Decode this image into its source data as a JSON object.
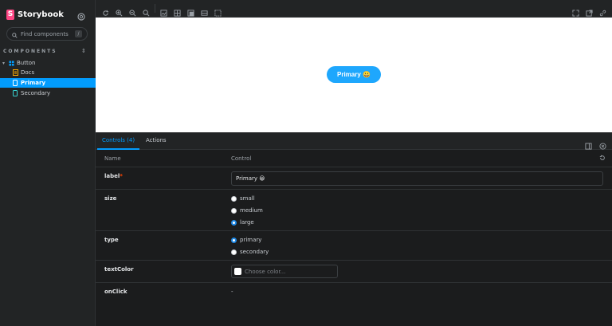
{
  "sidebar": {
    "brand": "Storybook",
    "brand_logo": "S",
    "search_placeholder": "Find components",
    "search_kbd": "/",
    "section_title": "COMPONENTS",
    "tree": {
      "group": "Button",
      "items": [
        {
          "label": "Docs",
          "icon": "docs-icon"
        },
        {
          "label": "Primary",
          "icon": "story-icon",
          "active": true
        },
        {
          "label": "Secondary",
          "icon": "story-icon"
        }
      ]
    }
  },
  "toolbar": {
    "icons": [
      "reload-icon",
      "zoom-in-icon",
      "zoom-out-icon",
      "zoom-reset-icon",
      "background-icon",
      "grid-icon",
      "viewport-icon",
      "measure-icon",
      "outline-icon",
      "fullscreen-icon",
      "open-new-tab-icon",
      "copy-link-icon"
    ]
  },
  "canvas": {
    "button_label": "Primary 😀",
    "button_color": "#1ea7fd"
  },
  "panel": {
    "tabs": [
      "Controls (4)",
      "Actions"
    ],
    "active_tab": "Controls (4)",
    "header": {
      "name": "Name",
      "control": "Control"
    },
    "rows": {
      "label": {
        "name": "label",
        "required": "*",
        "value": "Primary 😀"
      },
      "size": {
        "name": "size",
        "options": [
          "small",
          "medium",
          "large"
        ],
        "selected": "large"
      },
      "type": {
        "name": "type",
        "options": [
          "primary",
          "secondary"
        ],
        "selected": "primary"
      },
      "textColor": {
        "name": "textColor",
        "placeholder": "Choose color..."
      },
      "onClick": {
        "name": "onClick",
        "value": "-"
      }
    }
  },
  "colors": {
    "accent": "#029cfd",
    "brand": "#ff4785"
  }
}
